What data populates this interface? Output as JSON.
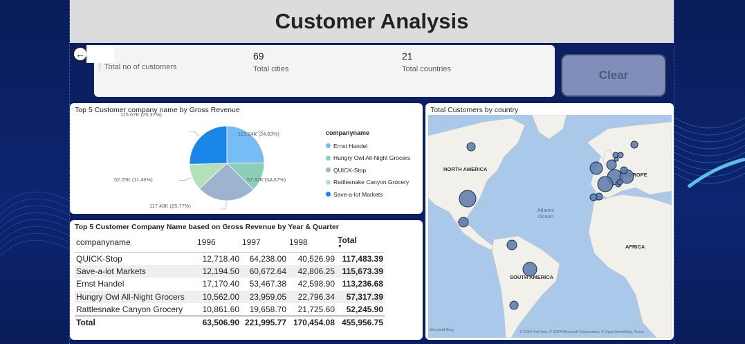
{
  "header": {
    "title": "Customer Analysis"
  },
  "kpis": [
    {
      "value": "",
      "label": "Total no of customers"
    },
    {
      "value": "69",
      "label": "Total cities"
    },
    {
      "value": "21",
      "label": "Total countries"
    }
  ],
  "clear_button": {
    "label": "Clear"
  },
  "pie_card": {
    "title": "Top 5 Customer company name by Gross Revenue",
    "legend_title": "companyname",
    "slice_labels": [
      "113.24K (24.83%)",
      "57.32K (12.57%)",
      "117.48K (25.77%)",
      "52.25K (11.46%)",
      "115.67K (25.37%)"
    ]
  },
  "chart_data": {
    "type": "pie",
    "title": "Top 5 Customer company name by Gross Revenue",
    "categories": [
      "Ernst Handel",
      "Hungry Owl All-Night Grocers",
      "QUICK-Stop",
      "Rattlesnake Canyon Grocery",
      "Save-a-lot Markets"
    ],
    "values": [
      113.24,
      57.32,
      117.48,
      52.25,
      115.67
    ],
    "colors": [
      "#76bcf5",
      "#8ccfb8",
      "#9db3cf",
      "#b4e0b9",
      "#1a86e8"
    ],
    "legend": "right"
  },
  "table_card": {
    "title": "Top 5 Customer Company Name based on Gross Revenue by Year & Quarter",
    "columns": [
      "companyname",
      "1996",
      "1997",
      "1998",
      "Total"
    ],
    "rows": [
      [
        "QUICK-Stop",
        "12,718.40",
        "64,238.00",
        "40,526.99",
        "117,483.39"
      ],
      [
        "Save-a-lot Markets",
        "12,194.50",
        "60,672.64",
        "42,806.25",
        "115,673.39"
      ],
      [
        "Ernst Handel",
        "17,170.40",
        "53,467.38",
        "42,598.90",
        "113,236.68"
      ],
      [
        "Hungry Owl All-Night Grocers",
        "10,562.00",
        "23,959.05",
        "22,796.34",
        "57,317.39"
      ],
      [
        "Rattlesnake Canyon Grocery",
        "10,861.60",
        "19,658.70",
        "21,725.60",
        "52,245.90"
      ]
    ],
    "total_row": [
      "Total",
      "63,506.90",
      "221,995.77",
      "170,454.08",
      "455,956.75"
    ]
  },
  "map_card": {
    "title": "Total Customers by country",
    "labels": {
      "north_america": "NORTH AMERICA",
      "europe": "EUROPE",
      "africa": "AFRICA",
      "south_america": "SOUTH AMERICA",
      "ocean": "Atlantic Ocean"
    },
    "footer_left": "Microsoft Bing",
    "footer_right": "© 2024 TomTom, © 2024 Microsoft Corporation, © OpenStreetMap, Terms"
  }
}
